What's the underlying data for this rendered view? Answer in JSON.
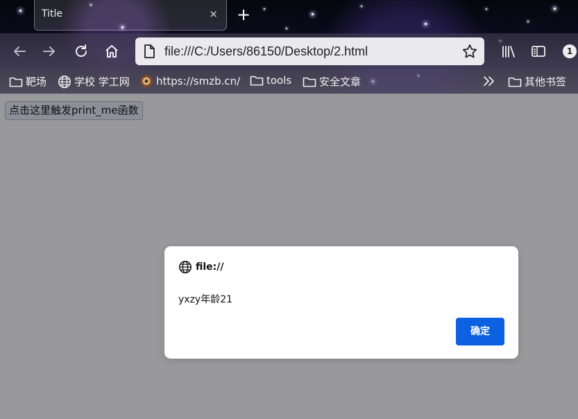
{
  "tab": {
    "title": "Title",
    "close_symbol": "×"
  },
  "new_tab_symbol": "+",
  "nav": {
    "url": "file:///C:/Users/86150/Desktop/2.html",
    "badge_count": "1"
  },
  "bookmarks": {
    "items": [
      {
        "label": "靶场",
        "icon": "folder-icon"
      },
      {
        "label": "学校 学工网",
        "icon": "globe-icon"
      },
      {
        "label": "https://smzb.cn/",
        "icon": "site-favicon-icon"
      },
      {
        "label": "tools",
        "icon": "folder-icon"
      },
      {
        "label": "安全文章",
        "icon": "folder-icon"
      }
    ],
    "other_label": "其他书签"
  },
  "page": {
    "button_label": "点击这里触发print_me函数"
  },
  "dialog": {
    "origin": "file://",
    "message": "yxzy年龄21",
    "ok_label": "确定",
    "ok_color": "#0b61e0"
  },
  "colors": {
    "page_background": "#99999c",
    "url_bar": "#e9e9ee"
  }
}
